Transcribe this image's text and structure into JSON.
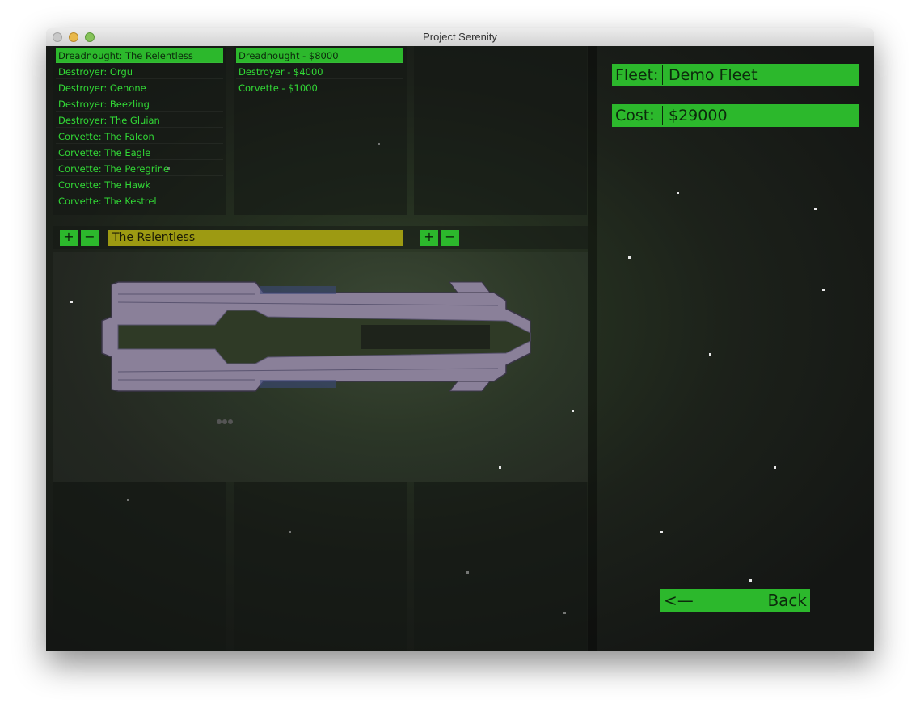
{
  "window": {
    "title": "Project Serenity"
  },
  "ships_list": [
    "Dreadnought: The Relentless",
    "Destroyer: Orgu",
    "Destroyer: Oenone",
    "Destroyer: Beezling",
    "Destroyer: The Gluian",
    "Corvette: The Falcon",
    "Corvette: The Eagle",
    "Corvette: The Peregrine",
    "Corvette: The Hawk",
    "Corvette: The Kestrel"
  ],
  "selected_ship_index": 0,
  "class_list": [
    "Dreadnought - $8000",
    "Destroyer - $4000",
    "Corvette - $1000"
  ],
  "selected_class_index": 0,
  "controls": {
    "add_label": "+",
    "remove_label": "−",
    "ship_name": "The Relentless",
    "add_label_2": "+",
    "remove_label_2": "−"
  },
  "fleet": {
    "label": "Fleet:",
    "value": "Demo Fleet"
  },
  "cost": {
    "label": "Cost:",
    "value": "$29000"
  },
  "back": {
    "arrow": "<—",
    "label": "Back"
  },
  "colors": {
    "accent_green": "#2cb82c",
    "name_field": "#9d9a12",
    "ship_hull": "#8a8099"
  }
}
